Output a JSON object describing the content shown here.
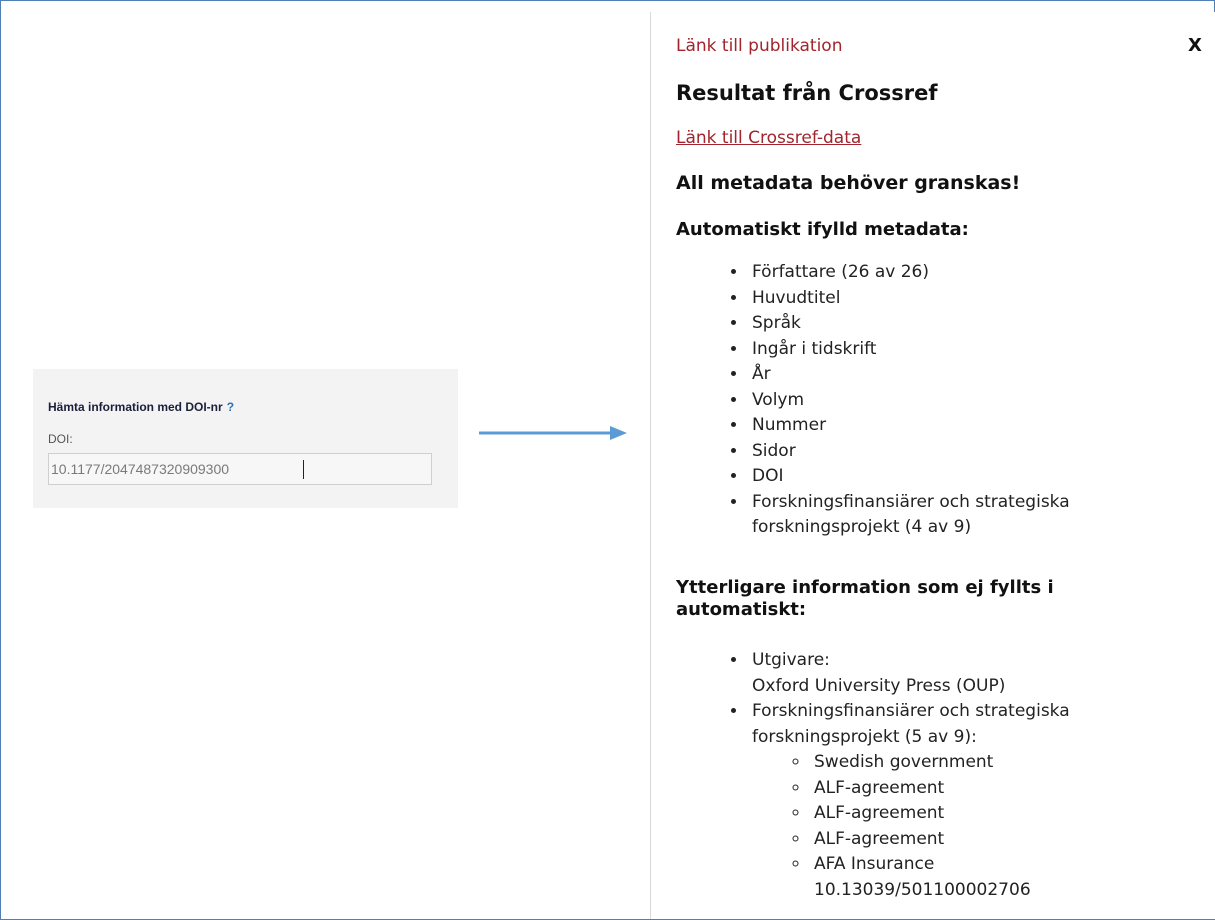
{
  "doi_form": {
    "title": "Hämta information med DOI-nr",
    "help": "?",
    "label": "DOI:",
    "value": "10.1177/2047487320909300"
  },
  "panel": {
    "link_title": "Länk till publikation",
    "close": "X",
    "heading": "Resultat från Crossref",
    "crossref_link": "Länk till Crossref-data",
    "warning": "All metadata behöver granskas!",
    "auto_heading": "Automatiskt ifylld metadata:",
    "auto_items": [
      "Författare (26 av 26)",
      "Huvudtitel",
      "Språk",
      "Ingår i tidskrift",
      "År",
      "Volym",
      "Nummer",
      "Sidor",
      "DOI",
      "Forskningsfinansiärer och strategiska forskningsprojekt (4 av 9)"
    ],
    "extra_heading": "Ytterligare information som ej fyllts i automatiskt:",
    "extra_publisher_label": "Utgivare:",
    "extra_publisher_value": "Oxford University Press (OUP)",
    "extra_funders_label": "Forskningsfinansiärer och strategiska forskningsprojekt (5 av 9):",
    "funders": [
      "Swedish government",
      "ALF-agreement",
      "ALF-agreement",
      "ALF-agreement",
      "AFA Insurance",
      "10.13039/501100002706"
    ]
  },
  "colors": {
    "link": "#a2242c",
    "arrow": "#5b9bd5",
    "frame": "#4f7fb3"
  }
}
